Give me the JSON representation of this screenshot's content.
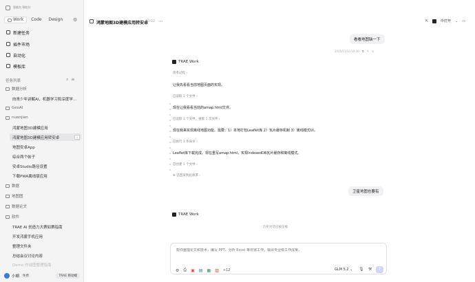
{
  "sidebar": {
    "top_text": "智能台    帮助分",
    "modes": [
      "Work",
      "Code",
      "Design"
    ],
    "nav": [
      {
        "label": "新建任务",
        "icon": "new-task-icon"
      },
      {
        "label": "插件市场",
        "icon": "plugin-market-icon"
      },
      {
        "label": "自动化",
        "icon": "automation-icon"
      },
      {
        "label": "模板库",
        "icon": "template-icon"
      }
    ],
    "task_list_header": "任务列表",
    "folder_1": "数据分析",
    "task_1": "向青少年讲解AI，机器学习和深度学...",
    "folder_2": "GeoAI",
    "folder_3": "nuanjian",
    "task_2": "鸿蒙地图3D建模应用",
    "task_3": "鸿蒙地图3D建模应用转安卓",
    "task_4": "地图安卓App",
    "task_5": "综合两个帖子",
    "task_6": "安卓Studio路径设置",
    "task_7": "下载PWA离线版应用",
    "folder_4": "数据",
    "folder_5": "地图图",
    "folder_6": "数据论文",
    "folder_7": "软件",
    "task_8": "TRAE AI 创造力大赛如赛指南",
    "task_9": "开发鸿蒙手机应用",
    "task_10": "整理文件夹",
    "task_11": "总结会议讨论内容",
    "task_12": "Demo 作战图整理指南",
    "user_name": "小胡",
    "user_plan": "免费",
    "trae_btn": "TRAE 移动端"
  },
  "header": {
    "title": "鸿蒙地图3D建模应用转安卓",
    "time": "17:22",
    "open_label": "中打开"
  },
  "chat": {
    "user_msg_1": "看看地图缺一下",
    "user_msg_1_meta": "2025/11/13 10:30",
    "agent_name": "TRAE Work",
    "think_label": "思考过程",
    "line_1": "让我先看看当前地图页面的实现。",
    "read_1": "已读取 1 个文件",
    "line_2": "现在让我看看当前的amap.html文件。",
    "read_2": "已读取 1 个文件，搜索 1 次文件",
    "line_3": "现在我来实现离线地图功能。需要：1）本地打包Leaflet库 2）瓦片缓存机制 3）离线模式UI。",
    "gen_1": "已执行 1 条命令",
    "line_4": "Leaflet库下载完成。现在重写amap.html，实现IndexedDB瓦片缓存和离线模式。",
    "edit_1": "已创建 1 个文件",
    "undo_label": "已回滚到此请求",
    "user_msg_2": "卫星地图也要有",
    "agent_name_2": "TRAE Work",
    "divider": "历史对话已被压缩"
  },
  "input": {
    "placeholder": "帮你整理论文和技术，编写 PPT、分析 Excel 等日常工作，输出专业级工作成果。",
    "plus_count": "+12",
    "model": "GLM 5.2"
  }
}
